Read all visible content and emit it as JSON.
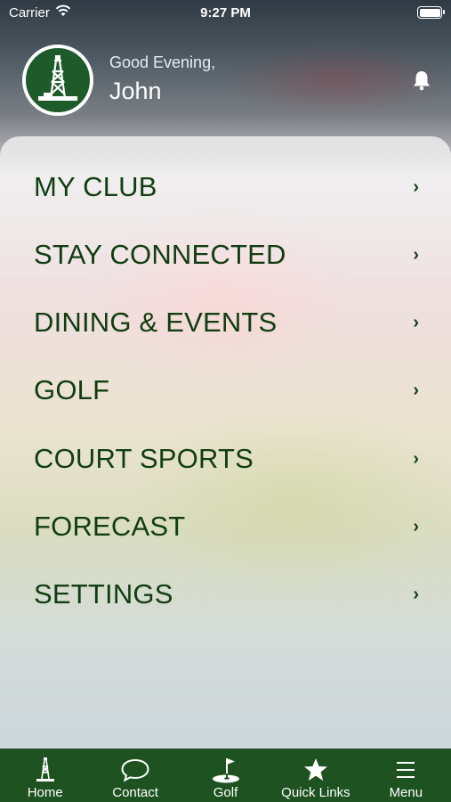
{
  "status_bar": {
    "carrier": "Carrier",
    "time": "9:27 PM"
  },
  "header": {
    "greeting": "Good Evening,",
    "name": "John"
  },
  "menu": {
    "items": [
      {
        "label": "MY CLUB"
      },
      {
        "label": "STAY CONNECTED"
      },
      {
        "label": "DINING & EVENTS"
      },
      {
        "label": "GOLF"
      },
      {
        "label": "COURT SPORTS"
      },
      {
        "label": "FORECAST"
      },
      {
        "label": "SETTINGS"
      }
    ]
  },
  "tabbar": {
    "items": [
      {
        "label": "Home",
        "icon": "lighthouse-icon"
      },
      {
        "label": "Contact",
        "icon": "chat-bubble-icon"
      },
      {
        "label": "Golf",
        "icon": "golf-flag-icon"
      },
      {
        "label": "Quick Links",
        "icon": "star-icon"
      },
      {
        "label": "Menu",
        "icon": "hamburger-icon"
      }
    ]
  },
  "colors": {
    "brand_green": "#1e5220",
    "menu_text": "#123d12"
  }
}
